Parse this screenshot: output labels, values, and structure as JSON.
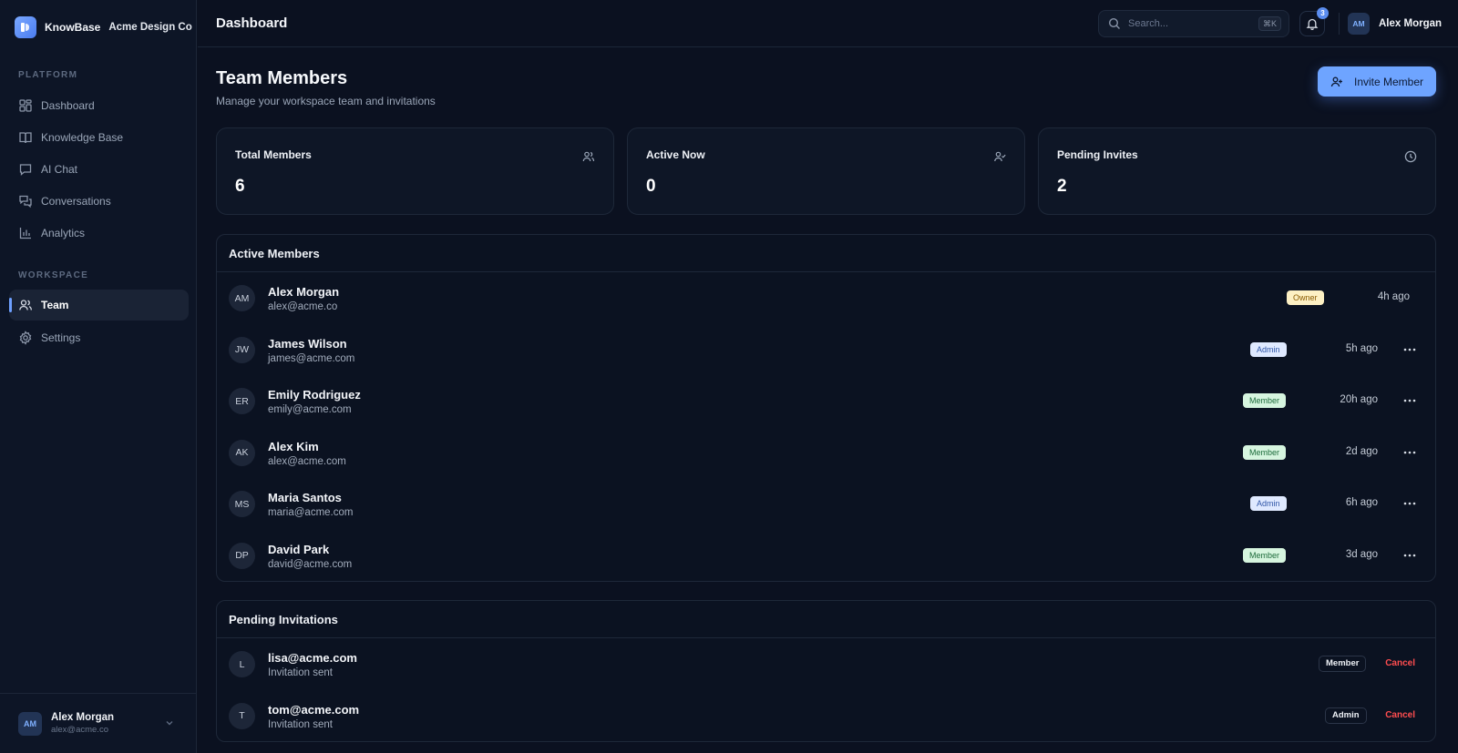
{
  "brand": {
    "name": "KnowBase",
    "workspace": "Acme Design Co"
  },
  "sidebar": {
    "sections": [
      {
        "label": "PLATFORM"
      },
      {
        "label": "WORKSPACE"
      }
    ],
    "items": [
      {
        "label": "Dashboard",
        "icon": "dashboard-icon"
      },
      {
        "label": "Knowledge Base",
        "icon": "book-icon"
      },
      {
        "label": "AI Chat",
        "icon": "chat-icon"
      },
      {
        "label": "Conversations",
        "icon": "conversations-icon"
      },
      {
        "label": "Analytics",
        "icon": "chart-icon"
      },
      {
        "label": "Team",
        "icon": "users-icon",
        "active": true
      },
      {
        "label": "Settings",
        "icon": "gear-icon"
      }
    ],
    "user": {
      "initials": "AM",
      "name": "Alex Morgan",
      "email": "alex@acme.co"
    }
  },
  "header": {
    "title": "Dashboard",
    "search_placeholder": "Search...",
    "search_shortcut": "⌘K",
    "notification_count": "3",
    "user_initials": "AM",
    "user_name": "Alex Morgan"
  },
  "page": {
    "title": "Team Members",
    "subtitle": "Manage your workspace team and invitations",
    "invite_label": "Invite Member"
  },
  "stats": [
    {
      "label": "Total Members",
      "value": "6",
      "icon": "users-icon"
    },
    {
      "label": "Active Now",
      "value": "0",
      "icon": "user-check-icon"
    },
    {
      "label": "Pending Invites",
      "value": "2",
      "icon": "clock-icon"
    }
  ],
  "active_members": {
    "title": "Active Members",
    "rows": [
      {
        "initials": "AM",
        "name": "Alex Morgan",
        "email": "alex@acme.co",
        "role": "Owner",
        "time": "4h ago"
      },
      {
        "initials": "JW",
        "name": "James Wilson",
        "email": "james@acme.com",
        "role": "Admin",
        "time": "5h ago"
      },
      {
        "initials": "ER",
        "name": "Emily Rodriguez",
        "email": "emily@acme.com",
        "role": "Member",
        "time": "20h ago"
      },
      {
        "initials": "AK",
        "name": "Alex Kim",
        "email": "alex@acme.com",
        "role": "Member",
        "time": "2d ago"
      },
      {
        "initials": "MS",
        "name": "Maria Santos",
        "email": "maria@acme.com",
        "role": "Admin",
        "time": "6h ago"
      },
      {
        "initials": "DP",
        "name": "David Park",
        "email": "david@acme.com",
        "role": "Member",
        "time": "3d ago"
      }
    ]
  },
  "pending_invitations": {
    "title": "Pending Invitations",
    "rows": [
      {
        "initial": "L",
        "email": "lisa@acme.com",
        "status": "Invitation sent",
        "role": "Member",
        "action": "Cancel"
      },
      {
        "initial": "T",
        "email": "tom@acme.com",
        "status": "Invitation sent",
        "role": "Admin",
        "action": "Cancel"
      }
    ]
  },
  "colors": {
    "background": "#0b1120",
    "accent": "#6ea4ff",
    "owner_badge": "#fdf0c4",
    "admin_badge": "#dfe9ff",
    "member_badge": "#d6f5df",
    "danger": "#ff4d4f"
  }
}
